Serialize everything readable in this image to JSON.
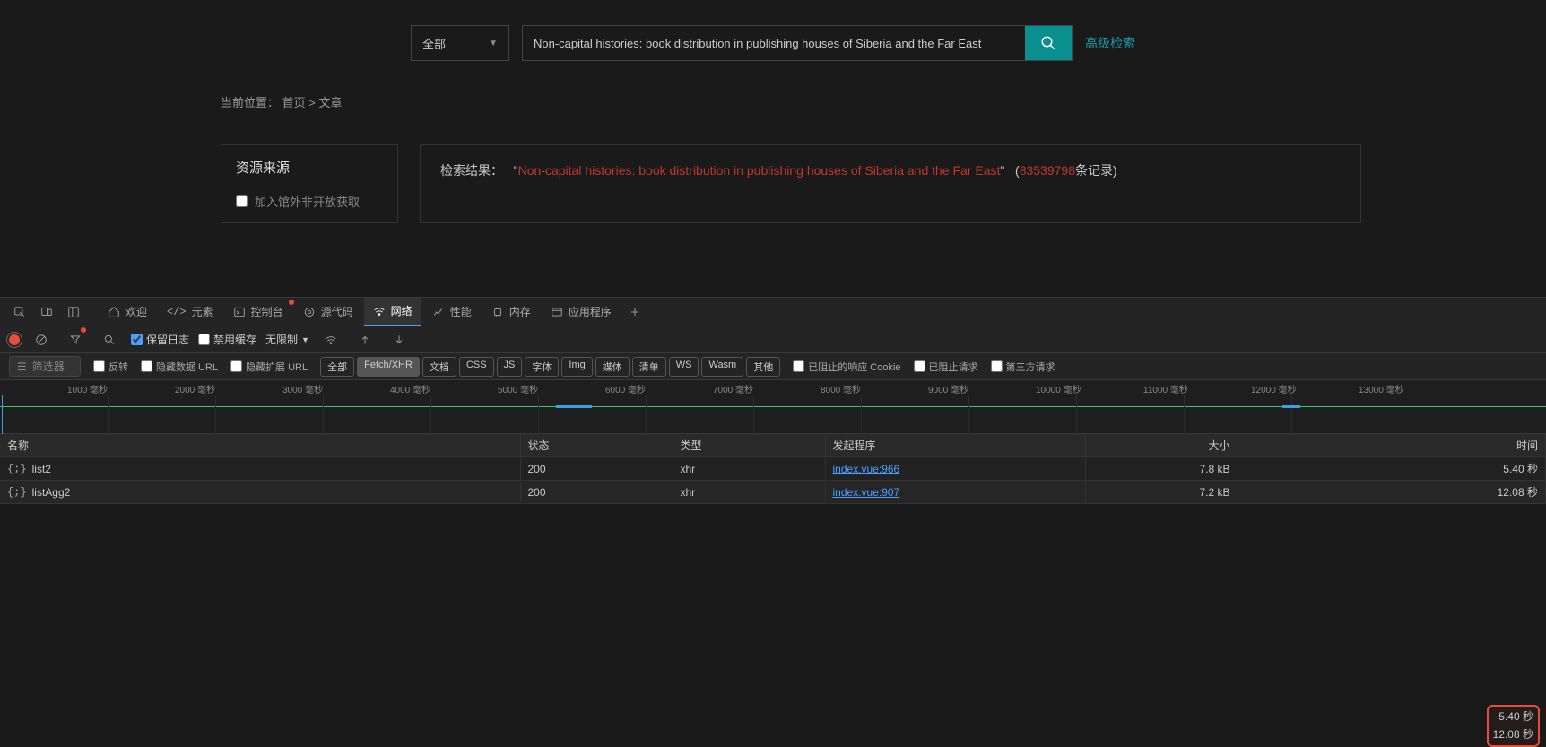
{
  "search": {
    "scope": "全部",
    "query": "Non-capital histories: book distribution in publishing houses of Siberia and the Far East",
    "advanced": "高级检索"
  },
  "breadcrumb": {
    "label": "当前位置：",
    "home": "首页",
    "sep": ">",
    "page": "文章"
  },
  "sidebar": {
    "title": "资源来源",
    "opt1": "加入馆外非开放获取"
  },
  "results": {
    "prefix": "检索结果：",
    "query": "Non-capital histories: book distribution in publishing houses of Siberia and the Far East",
    "count_num": "83539798",
    "count_suffix": "条记录"
  },
  "devtools": {
    "tabs": {
      "welcome": "欢迎",
      "elements": "元素",
      "console": "控制台",
      "sources": "源代码",
      "network": "网络",
      "performance": "性能",
      "memory": "内存",
      "application": "应用程序"
    },
    "toolbar": {
      "preserve_log": "保留日志",
      "disable_cache": "禁用缓存",
      "throttling": "无限制"
    },
    "filter": {
      "placeholder": "筛选器",
      "invert": "反转",
      "hide_data": "隐藏数据 URL",
      "hide_ext": "隐藏扩展 URL",
      "blocked_cookie": "已阻止的响应 Cookie",
      "blocked_req": "已阻止请求",
      "third_party": "第三方请求",
      "pills": {
        "all": "全部",
        "fetch": "Fetch/XHR",
        "doc": "文档",
        "css": "CSS",
        "js": "JS",
        "font": "字体",
        "img": "Img",
        "media": "媒体",
        "manifest": "清单",
        "ws": "WS",
        "wasm": "Wasm",
        "other": "其他"
      }
    },
    "ruler": [
      "1000 毫秒",
      "2000 毫秒",
      "3000 毫秒",
      "4000 毫秒",
      "5000 毫秒",
      "6000 毫秒",
      "7000 毫秒",
      "8000 毫秒",
      "9000 毫秒",
      "10000 毫秒",
      "11000 毫秒",
      "12000 毫秒",
      "13000 毫秒"
    ],
    "table": {
      "headers": {
        "name": "名称",
        "status": "状态",
        "type": "类型",
        "initiator": "发起程序",
        "size": "大小",
        "time": "时间"
      },
      "rows": [
        {
          "name": "list2",
          "status": "200",
          "type": "xhr",
          "initiator": "index.vue:966",
          "size": "7.8 kB",
          "time": "5.40 秒"
        },
        {
          "name": "listAgg2",
          "status": "200",
          "type": "xhr",
          "initiator": "index.vue:907",
          "size": "7.2 kB",
          "time": "12.08 秒"
        }
      ]
    }
  }
}
